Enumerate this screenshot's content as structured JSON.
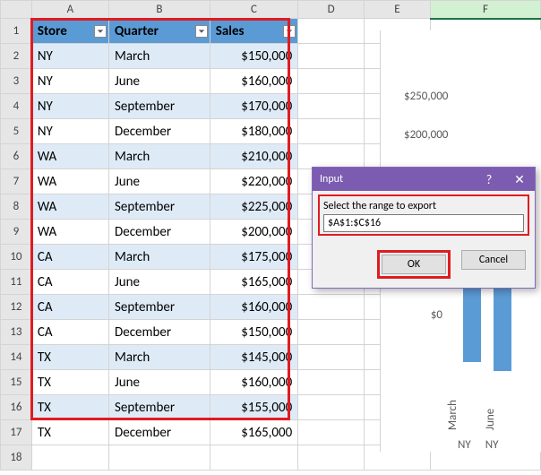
{
  "columns": [
    "A",
    "B",
    "C",
    "D",
    "E",
    "F"
  ],
  "headers": {
    "store": "Store",
    "quarter": "Quarter",
    "sales": "Sales"
  },
  "rows": [
    {
      "store": "NY",
      "quarter": "March",
      "sales": "$150,000"
    },
    {
      "store": "NY",
      "quarter": "June",
      "sales": "$160,000"
    },
    {
      "store": "NY",
      "quarter": "September",
      "sales": "$170,000"
    },
    {
      "store": "NY",
      "quarter": "December",
      "sales": "$180,000"
    },
    {
      "store": "WA",
      "quarter": "March",
      "sales": "$210,000"
    },
    {
      "store": "WA",
      "quarter": "June",
      "sales": "$220,000"
    },
    {
      "store": "WA",
      "quarter": "September",
      "sales": "$225,000"
    },
    {
      "store": "WA",
      "quarter": "December",
      "sales": "$200,000"
    },
    {
      "store": "CA",
      "quarter": "March",
      "sales": "$175,000"
    },
    {
      "store": "CA",
      "quarter": "June",
      "sales": "$165,000"
    },
    {
      "store": "CA",
      "quarter": "September",
      "sales": "$160,000"
    },
    {
      "store": "CA",
      "quarter": "December",
      "sales": "$150,000"
    },
    {
      "store": "TX",
      "quarter": "March",
      "sales": "$145,000"
    },
    {
      "store": "TX",
      "quarter": "June",
      "sales": "$160,000"
    },
    {
      "store": "TX",
      "quarter": "September",
      "sales": "$155,000"
    },
    {
      "store": "TX",
      "quarter": "December",
      "sales": "$165,000"
    }
  ],
  "row_numbers": [
    "1",
    "2",
    "3",
    "4",
    "5",
    "6",
    "7",
    "8",
    "9",
    "10",
    "11",
    "12",
    "13",
    "14",
    "15",
    "16",
    "17",
    "18"
  ],
  "chart": {
    "yticks": [
      "$250,000",
      "$200,000"
    ],
    "zero": "$0",
    "xlabels": [
      "March",
      "June"
    ],
    "series": [
      "NY",
      "NY"
    ]
  },
  "dialog": {
    "title": "Input",
    "help": "?",
    "close": "✕",
    "label": "Select the range to export",
    "value": "$A$1:$C$16",
    "ok": "OK",
    "cancel": "Cancel"
  }
}
